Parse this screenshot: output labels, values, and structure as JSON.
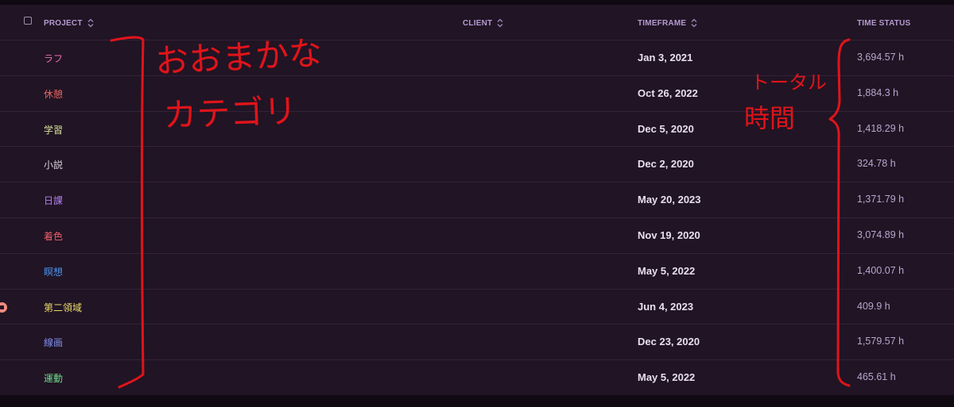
{
  "table": {
    "headers": {
      "project": "PROJECT",
      "client": "CLIENT",
      "timeframe": "TIMEFRAME",
      "time_status": "TIME STATUS"
    },
    "rows": [
      {
        "name": "ラフ",
        "color": "#e46fb2",
        "date": "Jan 3, 2021",
        "time": "3,694.57 h"
      },
      {
        "name": "休憩",
        "color": "#e8645f",
        "date": "Oct 26, 2022",
        "time": "1,884.3 h"
      },
      {
        "name": "学習",
        "color": "#d8e29a",
        "date": "Dec 5, 2020",
        "time": "1,418.29 h"
      },
      {
        "name": "小説",
        "color": "#d9d2dc",
        "date": "Dec 2, 2020",
        "time": "324.78 h"
      },
      {
        "name": "日課",
        "color": "#b27ef0",
        "date": "May 20, 2023",
        "time": "1,371.79 h"
      },
      {
        "name": "着色",
        "color": "#e85c6a",
        "date": "Nov 19, 2020",
        "time": "3,074.89 h"
      },
      {
        "name": "瞑想",
        "color": "#4c94f0",
        "date": "May 5, 2022",
        "time": "1,400.07 h"
      },
      {
        "name": "第二領域",
        "color": "#eadb6a",
        "date": "Jun 4, 2023",
        "time": "409.9 h"
      },
      {
        "name": "線画",
        "color": "#7f8ff0",
        "date": "Dec 23, 2020",
        "time": "1,579.57 h"
      },
      {
        "name": "運動",
        "color": "#6fd88a",
        "date": "May 5, 2022",
        "time": "465.61 h"
      }
    ]
  },
  "annotations": {
    "left_note_line1": "おおまかな",
    "left_note_line2": "カテゴリ",
    "right_note_line1": "トータル",
    "right_note_line2": "時間",
    "ink_color": "#e0141a"
  }
}
